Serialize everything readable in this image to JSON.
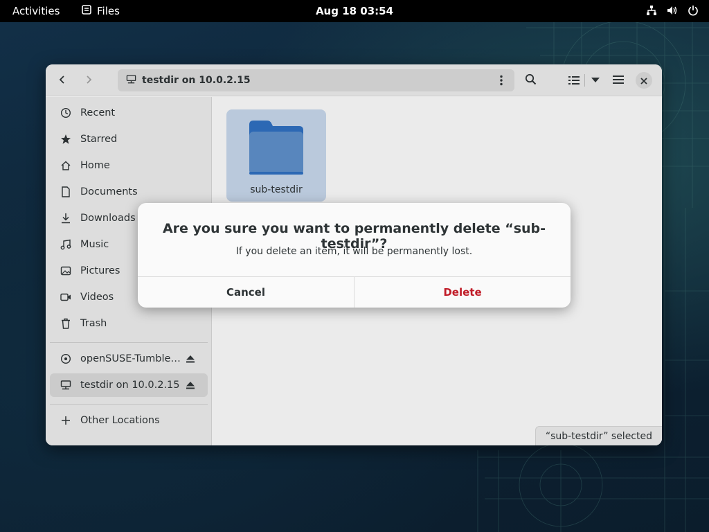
{
  "topbar": {
    "activities": "Activities",
    "app_name": "Files",
    "clock": "Aug 18  03:54"
  },
  "headerbar": {
    "path": "testdir on 10.0.2.15"
  },
  "sidebar": {
    "items": [
      {
        "label": "Recent",
        "icon": "clock-icon"
      },
      {
        "label": "Starred",
        "icon": "star-icon"
      },
      {
        "label": "Home",
        "icon": "home-icon"
      },
      {
        "label": "Documents",
        "icon": "document-icon"
      },
      {
        "label": "Downloads",
        "icon": "download-icon"
      },
      {
        "label": "Music",
        "icon": "music-icon"
      },
      {
        "label": "Pictures",
        "icon": "picture-icon"
      },
      {
        "label": "Videos",
        "icon": "video-icon"
      },
      {
        "label": "Trash",
        "icon": "trash-icon"
      }
    ],
    "mounts": [
      {
        "label": "openSUSE-Tumble…",
        "icon": "disc-icon"
      },
      {
        "label": "testdir on 10.0.2.15",
        "icon": "network-folder-icon",
        "active": true
      }
    ],
    "other_locations": "Other Locations"
  },
  "content": {
    "files": [
      {
        "name": "sub-testdir",
        "selected": true
      }
    ],
    "status": "“sub-testdir” selected"
  },
  "dialog": {
    "heading": "Are you sure you want to permanently delete “sub-testdir”?",
    "body": "If you delete an item, it will be permanently lost.",
    "cancel_label": "Cancel",
    "delete_label": "Delete"
  },
  "colors": {
    "accent": "#3584e4",
    "destructive": "#c01c28",
    "folder": "#5e8fc9",
    "selection": "#c6d6ea"
  }
}
